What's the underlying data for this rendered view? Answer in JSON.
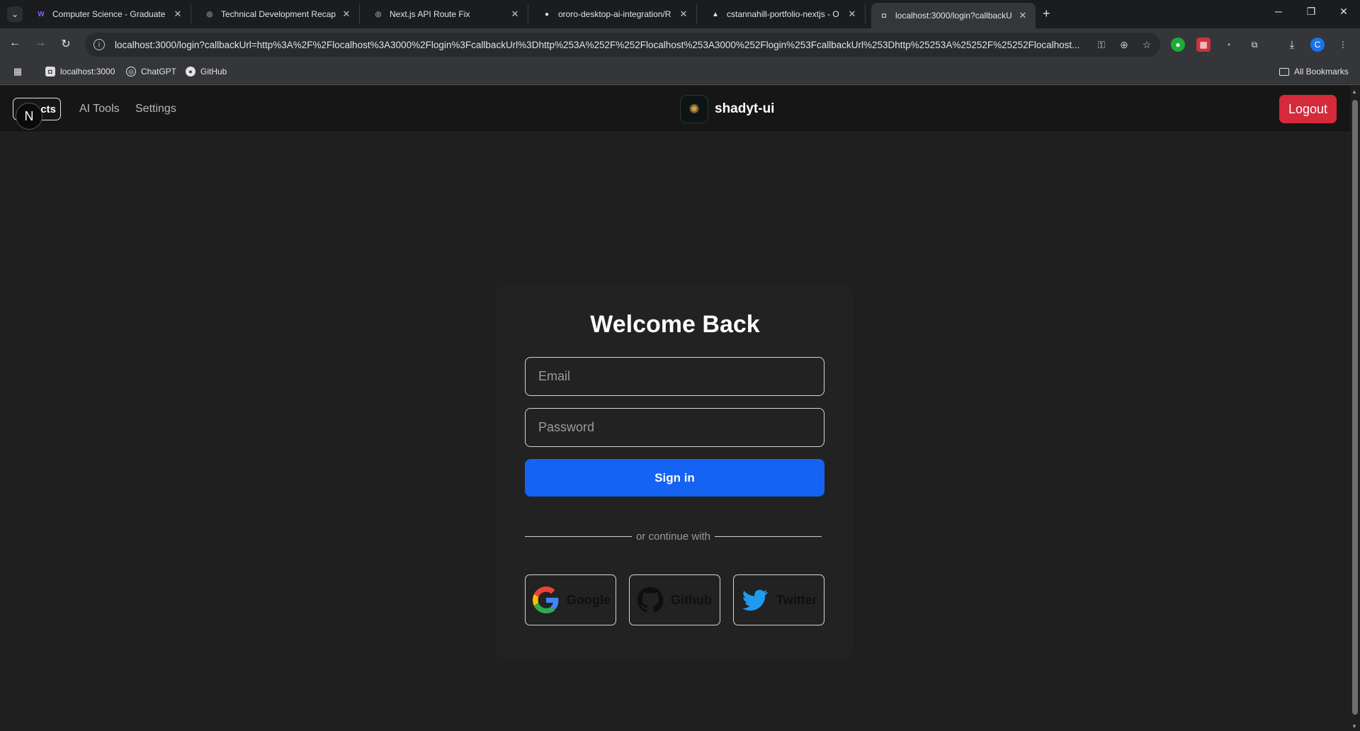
{
  "browser": {
    "tabs": [
      {
        "label": "Computer Science - Graduate P",
        "favicon": "W"
      },
      {
        "label": "Technical Development Recap",
        "favicon": "◎"
      },
      {
        "label": "Next.js API Route Fix",
        "favicon": "◎"
      },
      {
        "label": "ororo-desktop-ai-integration/R",
        "favicon": "●"
      },
      {
        "label": "cstannahill-portfolio-nextjs - O",
        "favicon": "▲"
      },
      {
        "label": "localhost:3000/login?callbackU",
        "favicon": "◘"
      }
    ],
    "url": "localhost:3000/login?callbackUrl=http%3A%2F%2Flocalhost%3A3000%2Flogin%3FcallbackUrl%3Dhttp%253A%252F%252Flocalhost%253A3000%252Flogin%253FcallbackUrl%253Dhttp%25253A%25252F%25252Flocalhost...",
    "bookmarks": [
      {
        "label": "localhost:3000"
      },
      {
        "label": "ChatGPT"
      },
      {
        "label": "GitHub"
      }
    ],
    "all_bookmarks": "All Bookmarks",
    "profile_initial": "C"
  },
  "app": {
    "nav_box_label": "cts",
    "nav_badge": "N",
    "nav_links": [
      "AI Tools",
      "Settings"
    ],
    "brand_name": "shadyt-ui",
    "logout_label": "Logout"
  },
  "login": {
    "title": "Welcome Back",
    "email_placeholder": "Email",
    "password_placeholder": "Password",
    "signin_label": "Sign in",
    "divider_text": "or continue with",
    "providers": [
      "Google",
      "Github",
      "Twitter"
    ]
  }
}
